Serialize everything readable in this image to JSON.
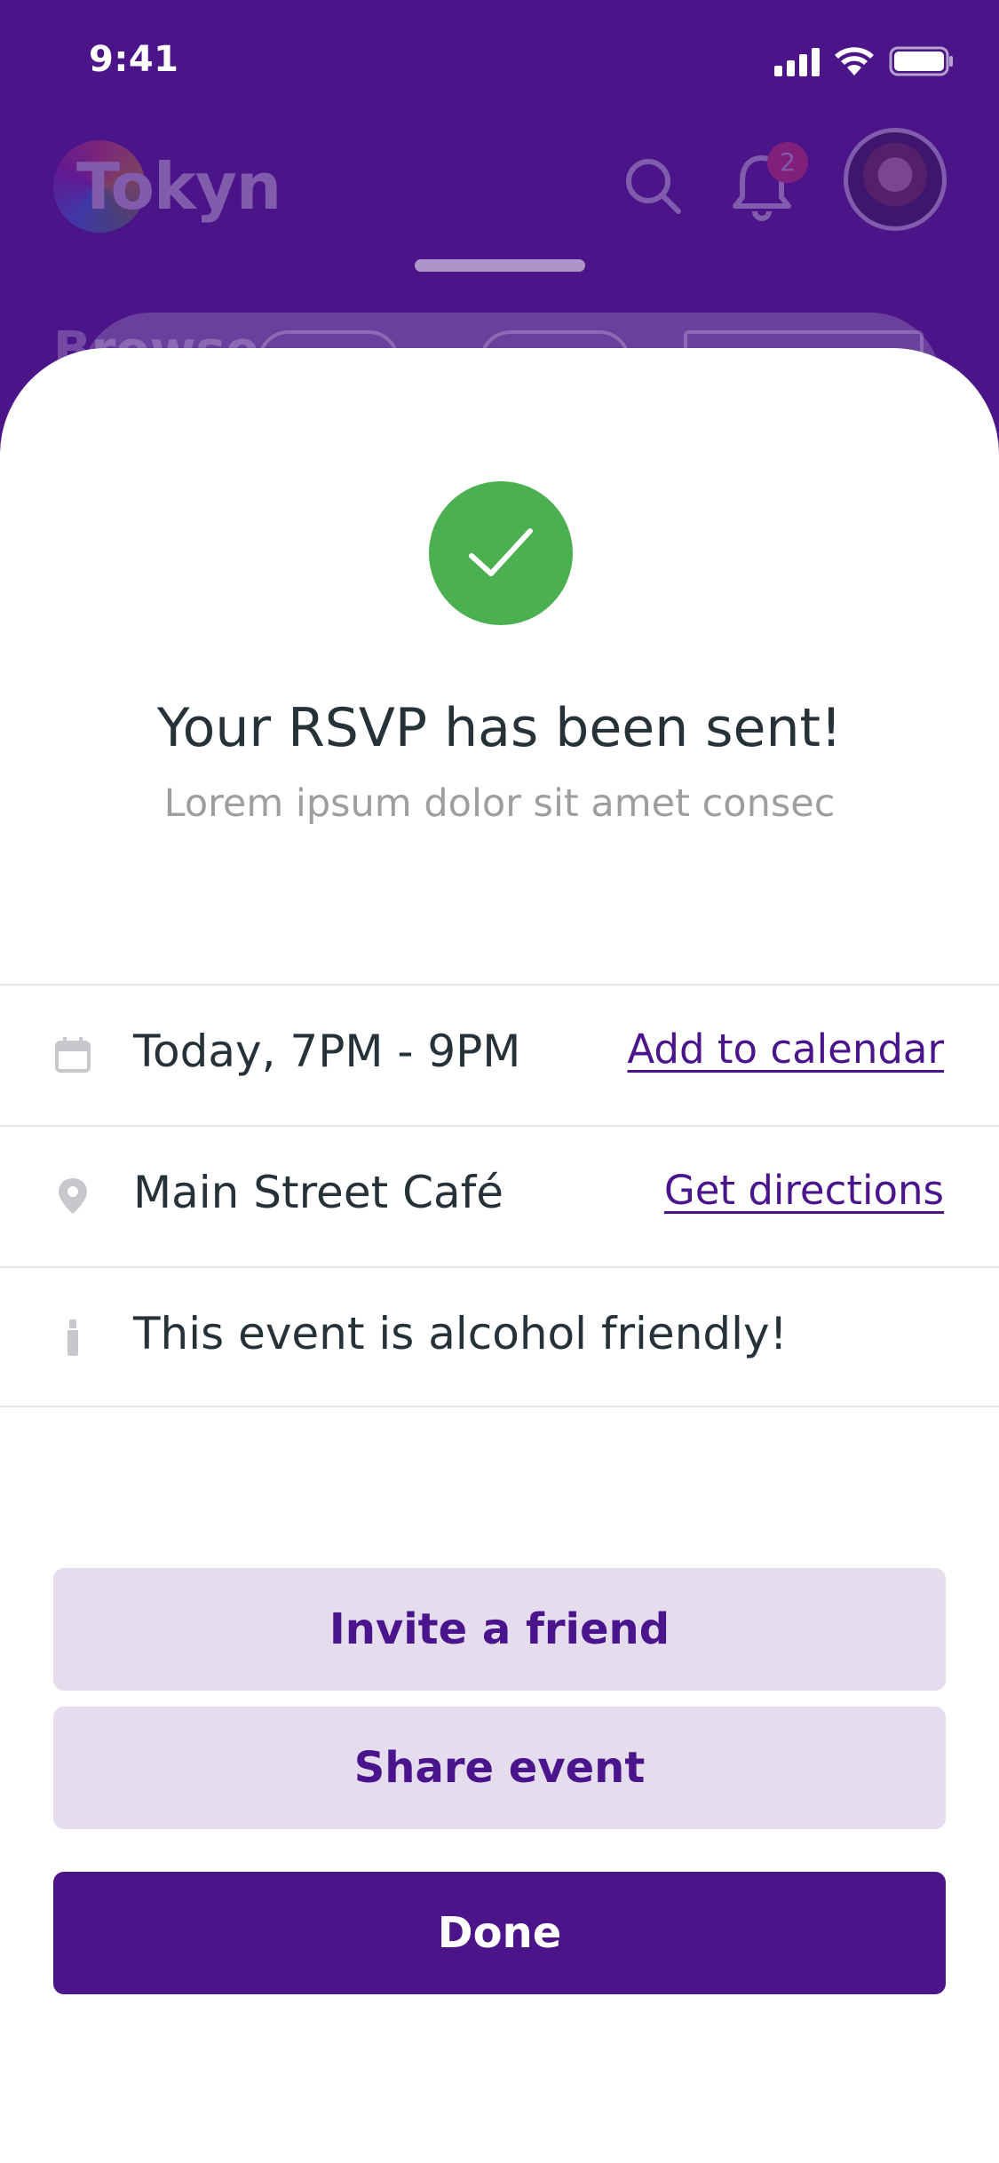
{
  "status_bar": {
    "time": "9:41"
  },
  "header": {
    "logo_text": "Tokyn",
    "notification_count": "2",
    "icons": [
      "search-icon",
      "bell-icon",
      "avatar"
    ]
  },
  "behind": {
    "browse_label": "Browse"
  },
  "confirmation": {
    "title": "Your RSVP has been sent!",
    "subtitle": "Lorem ipsum dolor sit amet consec",
    "icon": "check-icon"
  },
  "details": [
    {
      "icon": "calendar-icon",
      "text": "Today, 7PM - 9PM",
      "link": "Add to calendar"
    },
    {
      "icon": "location-pin-icon",
      "text": "Main Street Café",
      "link": "Get directions"
    },
    {
      "icon": "bottle-icon",
      "text": "This event is alcohol friendly!",
      "link": ""
    }
  ],
  "actions": {
    "invite_label": "Invite a friend",
    "share_label": "Share event",
    "done_label": "Done"
  },
  "colors": {
    "brand_purple": "#4b1589",
    "success_green": "#4caf50",
    "secondary_button": "#e5dcee",
    "text_dark": "#263238",
    "text_muted": "#9e9e9e",
    "badge_red": "#ff3b5c"
  }
}
